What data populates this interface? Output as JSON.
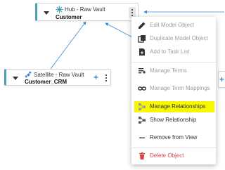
{
  "colors": {
    "accent_teal": "#4aa3b5",
    "connector_blue": "#3a8bd8",
    "highlight_yellow": "#f7f700",
    "danger_red": "#d64545"
  },
  "hub": {
    "type_label": "Hub - Raw Vault",
    "name": "Customer",
    "icon": "hub-star-icon"
  },
  "satellite": {
    "type_label": "Satellite - Raw Vault",
    "name": "Customer_CRM",
    "icon": "satellite-icon"
  },
  "context_menu": {
    "items": [
      {
        "label": "Edit Model Object",
        "icon": "pencil-icon",
        "state": "disabled"
      },
      {
        "label": "Duplicate Model Object",
        "icon": "copy-icon",
        "state": "disabled"
      },
      {
        "label": "Add to Task List",
        "icon": "task-list-icon",
        "state": "disabled"
      },
      {
        "label": "Manage Terms",
        "icon": "terms-icon",
        "state": "disabled"
      },
      {
        "label": "Manage Term Mappings",
        "icon": "link-icon",
        "state": "disabled"
      },
      {
        "label": "Manage Relationships",
        "icon": "relationships-icon",
        "state": "highlighted"
      },
      {
        "label": "Show Relationship",
        "icon": "show-relationship-icon",
        "state": "normal"
      },
      {
        "label": "Remove from View",
        "icon": "remove-icon",
        "state": "normal"
      },
      {
        "label": "Delete Object",
        "icon": "trash-icon",
        "state": "danger"
      }
    ]
  }
}
